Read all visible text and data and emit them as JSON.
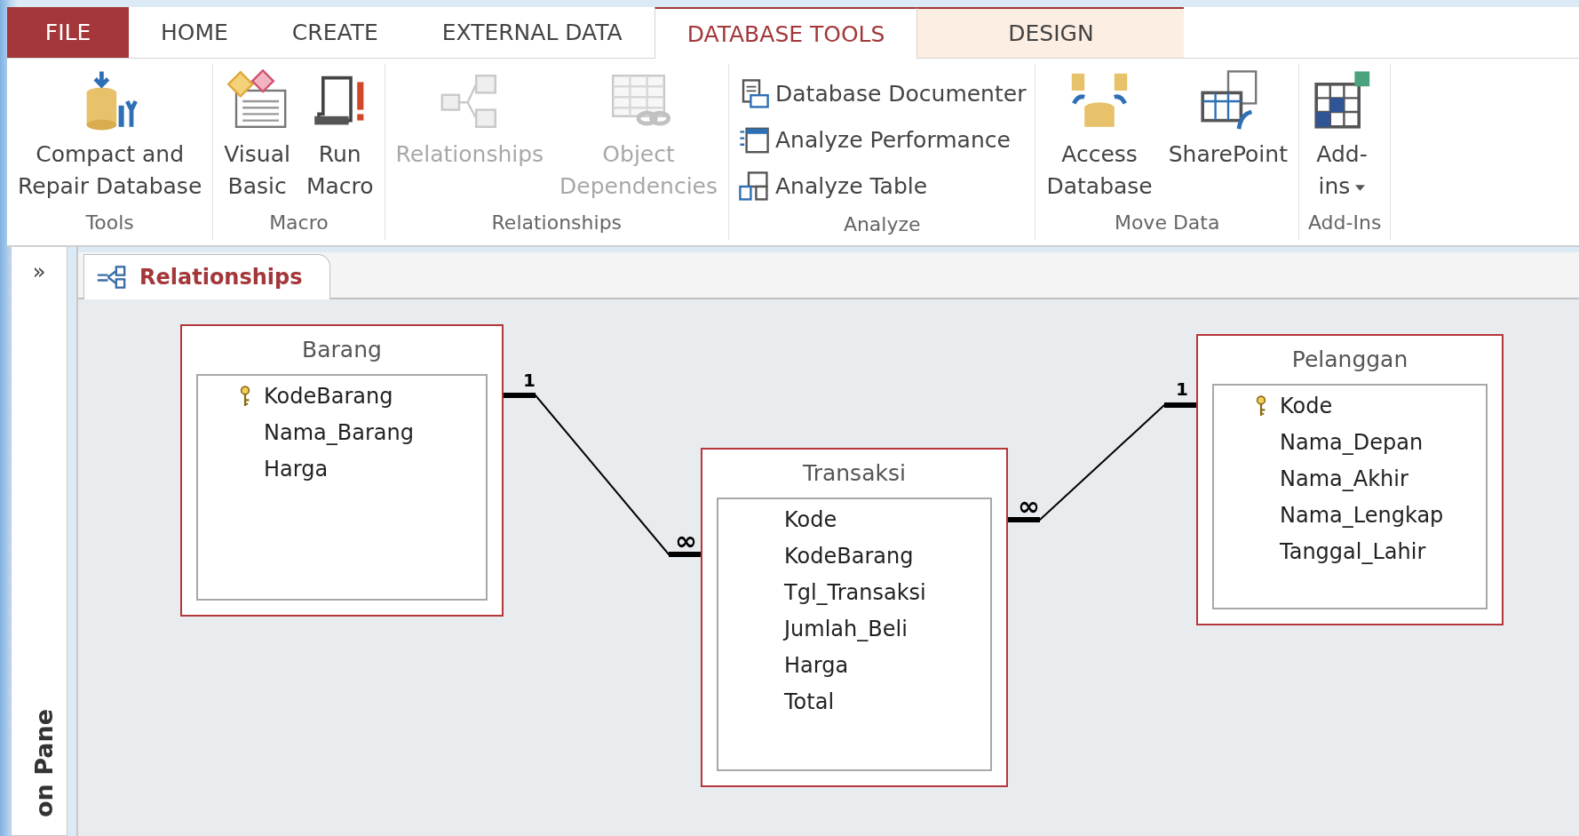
{
  "tabs": [
    {
      "label": "FILE",
      "kind": "file",
      "selected": false
    },
    {
      "label": "HOME",
      "kind": "normal",
      "selected": false
    },
    {
      "label": "CREATE",
      "kind": "normal",
      "selected": false
    },
    {
      "label": "EXTERNAL DATA",
      "kind": "normal",
      "selected": false
    },
    {
      "label": "DATABASE TOOLS",
      "kind": "normal",
      "selected": true
    },
    {
      "label": "DESIGN",
      "kind": "contextual",
      "selected": false
    }
  ],
  "ribbon_groups": [
    {
      "label": "Tools",
      "kind": "large",
      "buttons": [
        {
          "label": "Compact and\nRepair Database",
          "disabled": false,
          "dropdown": false
        }
      ]
    },
    {
      "label": "Macro",
      "kind": "large",
      "buttons": [
        {
          "label": "Visual\nBasic",
          "disabled": false,
          "dropdown": false
        },
        {
          "label": "Run\nMacro",
          "disabled": false,
          "dropdown": false
        }
      ]
    },
    {
      "label": "Relationships",
      "kind": "large",
      "buttons": [
        {
          "label": "Relationships",
          "disabled": true,
          "dropdown": false
        },
        {
          "label": "Object\nDependencies",
          "disabled": true,
          "dropdown": false
        }
      ]
    },
    {
      "label": "Analyze",
      "kind": "small",
      "buttons": [
        {
          "label": "Database Documenter",
          "disabled": false,
          "dropdown": false
        },
        {
          "label": "Analyze Performance",
          "disabled": false,
          "dropdown": false
        },
        {
          "label": "Analyze Table",
          "disabled": false,
          "dropdown": false
        }
      ]
    },
    {
      "label": "Move Data",
      "kind": "large",
      "buttons": [
        {
          "label": "Access\nDatabase",
          "disabled": false,
          "dropdown": false
        },
        {
          "label": "SharePoint",
          "disabled": false,
          "dropdown": false
        }
      ]
    },
    {
      "label": "Add-Ins",
      "kind": "large",
      "buttons": [
        {
          "label": "Add-\nins",
          "disabled": false,
          "dropdown": true
        }
      ]
    }
  ],
  "navigation_pane": {
    "expand_button": "»",
    "title": "on Pane"
  },
  "document_tab": {
    "title": "Relationships"
  },
  "tables": [
    {
      "name": "Barang",
      "fields": [
        {
          "name": "KodeBarang",
          "primary_key": true
        },
        {
          "name": "Nama_Barang",
          "primary_key": false
        },
        {
          "name": "Harga",
          "primary_key": false
        }
      ]
    },
    {
      "name": "Transaksi",
      "fields": [
        {
          "name": "Kode",
          "primary_key": false
        },
        {
          "name": "KodeBarang",
          "primary_key": false
        },
        {
          "name": "Tgl_Transaksi",
          "primary_key": false
        },
        {
          "name": "Jumlah_Beli",
          "primary_key": false
        },
        {
          "name": "Harga",
          "primary_key": false
        },
        {
          "name": "Total",
          "primary_key": false
        }
      ]
    },
    {
      "name": "Pelanggan",
      "fields": [
        {
          "name": "Kode",
          "primary_key": true
        },
        {
          "name": "Nama_Depan",
          "primary_key": false
        },
        {
          "name": "Nama_Akhir",
          "primary_key": false
        },
        {
          "name": "Nama_Lengkap",
          "primary_key": false
        },
        {
          "name": "Tanggal_Lahir",
          "primary_key": false
        }
      ]
    }
  ],
  "relationships": [
    {
      "one_label": "1",
      "many_label": "∞"
    },
    {
      "one_label": "1",
      "many_label": "∞"
    }
  ]
}
